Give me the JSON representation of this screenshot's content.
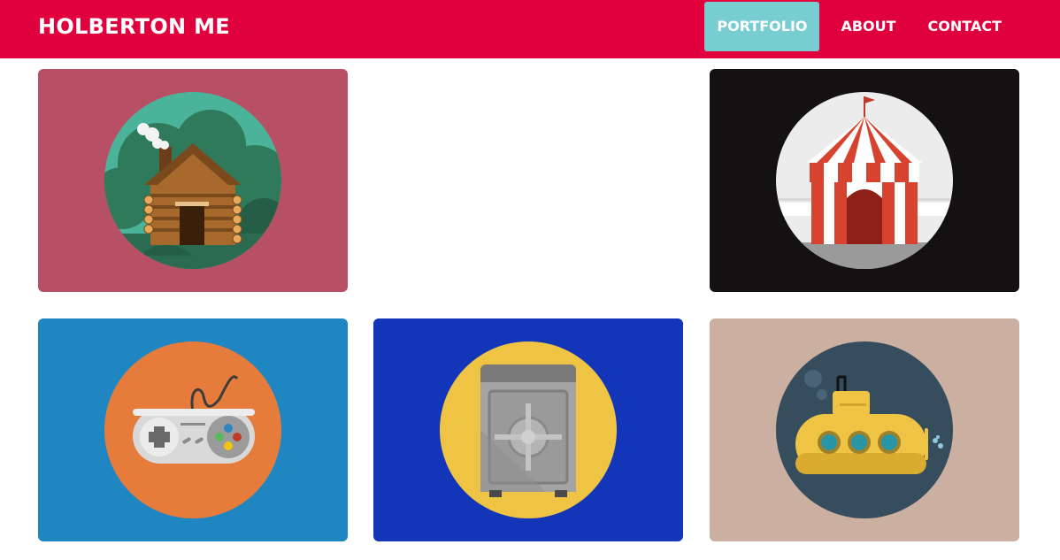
{
  "header": {
    "brand": "HOLBERTON ME",
    "nav": [
      {
        "label": "PORTFOLIO",
        "active": true
      },
      {
        "label": "ABOUT",
        "active": false
      },
      {
        "label": "CONTACT",
        "active": false
      }
    ]
  },
  "colors": {
    "header_bg": "#e1003e",
    "active_nav_bg": "#78cdd1"
  },
  "portfolio": [
    {
      "illustration": "log-cabin",
      "bg": "#b75064"
    },
    {
      "illustration": "circus-tent",
      "bg": "#141112"
    },
    {
      "illustration": "game-controller",
      "bg": "#1f86c2"
    },
    {
      "illustration": "safe",
      "bg": "#1336b8"
    },
    {
      "illustration": "submarine",
      "bg": "#cbb0a1"
    }
  ]
}
